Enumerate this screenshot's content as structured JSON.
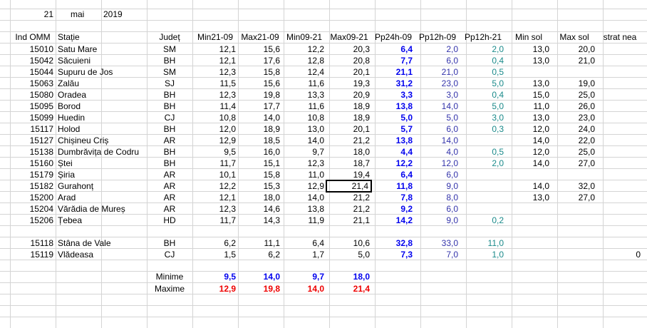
{
  "date": {
    "day": "21",
    "month": "mai",
    "year": "2019"
  },
  "headers": [
    "Ind OMM",
    "Stație",
    "Județ",
    "Min21-09",
    "Max21-09",
    "Min09-21",
    "Max09-21",
    "Pp24h-09",
    "Pp12h-09",
    "Pp12h-21",
    "Min sol",
    "Max sol",
    "strat nea"
  ],
  "rows": [
    [
      "15010",
      "Satu Mare",
      "SM",
      "12,1",
      "15,6",
      "12,2",
      "20,3",
      "6,4",
      "2,0",
      "2,0",
      "13,0",
      "20,0",
      ""
    ],
    [
      "15042",
      "Săcuieni",
      "BH",
      "12,1",
      "17,6",
      "12,8",
      "20,8",
      "7,7",
      "6,0",
      "0,4",
      "13,0",
      "21,0",
      ""
    ],
    [
      "15044",
      "Supuru de Jos",
      "SM",
      "12,3",
      "15,8",
      "12,4",
      "20,1",
      "21,1",
      "21,0",
      "0,5",
      "",
      "",
      ""
    ],
    [
      "15063",
      "Zalău",
      "SJ",
      "11,5",
      "15,6",
      "11,6",
      "19,3",
      "31,2",
      "23,0",
      "5,0",
      "13,0",
      "19,0",
      ""
    ],
    [
      "15080",
      "Oradea",
      "BH",
      "12,3",
      "19,8",
      "13,3",
      "20,9",
      "3,3",
      "3,0",
      "0,4",
      "15,0",
      "25,0",
      ""
    ],
    [
      "15095",
      "Borod",
      "BH",
      "11,4",
      "17,7",
      "11,6",
      "18,9",
      "13,8",
      "14,0",
      "5,0",
      "11,0",
      "26,0",
      ""
    ],
    [
      "15099",
      "Huedin",
      "CJ",
      "10,8",
      "14,0",
      "10,8",
      "18,9",
      "5,0",
      "5,0",
      "3,0",
      "13,0",
      "23,0",
      ""
    ],
    [
      "15117",
      "Holod",
      "BH",
      "12,0",
      "18,9",
      "13,0",
      "20,1",
      "5,7",
      "6,0",
      "0,3",
      "12,0",
      "24,0",
      ""
    ],
    [
      "15127",
      "Chișineu    Criș",
      "AR",
      "12,9",
      "18,5",
      "14,0",
      "21,2",
      "13,8",
      "14,0",
      "",
      "14,0",
      "22,0",
      ""
    ],
    [
      "15138",
      "Dumbrăvița de Codru",
      "BH",
      "9,5",
      "16,0",
      "9,7",
      "18,0",
      "4,4",
      "4,0",
      "0,5",
      "12,0",
      "25,0",
      ""
    ],
    [
      "15160",
      "Ștei",
      "BH",
      "11,7",
      "15,1",
      "12,3",
      "18,7",
      "12,2",
      "12,0",
      "2,0",
      "14,0",
      "27,0",
      ""
    ],
    [
      "15179",
      "Șiria",
      "AR",
      "10,1",
      "15,8",
      "11,0",
      "19,4",
      "6,4",
      "6,0",
      "",
      "",
      "",
      ""
    ],
    [
      "15182",
      "Gurahonț",
      "AR",
      "12,2",
      "15,3",
      "12,9",
      "21,4",
      "11,8",
      "9,0",
      "",
      "14,0",
      "32,0",
      ""
    ],
    [
      "15200",
      "Arad",
      "AR",
      "12,1",
      "18,0",
      "14,0",
      "21,2",
      "7,8",
      "8,0",
      "",
      "13,0",
      "27,0",
      ""
    ],
    [
      "15204",
      "Vărădia de Mureș",
      "AR",
      "12,3",
      "14,6",
      "13,8",
      "21,2",
      "9,2",
      "6,0",
      "",
      "",
      "",
      ""
    ],
    [
      "15206",
      "Țebea",
      "HD",
      "11,7",
      "14,3",
      "11,9",
      "21,1",
      "14,2",
      "9,0",
      "0,2",
      "",
      "",
      ""
    ],
    [
      "15118",
      "Stâna de Vale",
      "BH",
      "6,2",
      "11,1",
      "6,4",
      "10,6",
      "32,8",
      "33,0",
      "11,0",
      "",
      "",
      ""
    ],
    [
      "15119",
      "Vlădeasa",
      "CJ",
      "1,5",
      "6,2",
      "1,7",
      "5,0",
      "7,3",
      "7,0",
      "1,0",
      "",
      "",
      "0"
    ]
  ],
  "summary": {
    "min_label": "Minime",
    "max_label": "Maxime",
    "min_values": [
      "9,5",
      "14,0",
      "9,7",
      "18,0"
    ],
    "max_values": [
      "12,9",
      "19,8",
      "14,0",
      "21,4"
    ]
  },
  "colors": {
    "bold_blue": "#0000ee",
    "navy": "#3333aa",
    "teal": "#1a8a8a",
    "red": "#ee0000",
    "grid": "#d4d4d4"
  }
}
